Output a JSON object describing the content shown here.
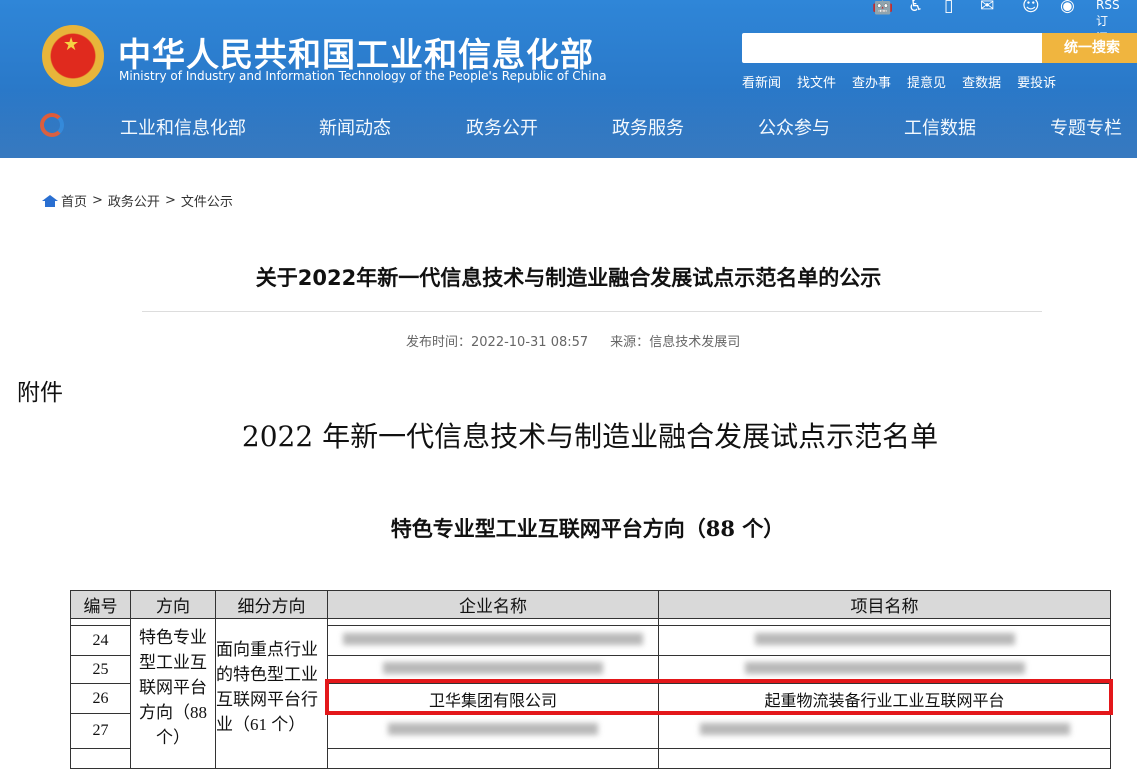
{
  "header": {
    "site_name_cn": "中华人民共和国工业和信息化部",
    "site_name_en": "Ministry of Industry and Information Technology of the People's Republic of China",
    "top_links": {
      "rss": "RSS订阅"
    },
    "search": {
      "placeholder": "",
      "button": "统一搜索"
    },
    "quick_links": [
      "看新闻",
      "找文件",
      "查办事",
      "提意见",
      "查数据",
      "要投诉"
    ],
    "nav": [
      "工业和信息化部",
      "新闻动态",
      "政务公开",
      "政务服务",
      "公众参与",
      "工信数据",
      "专题专栏"
    ]
  },
  "breadcrumb": [
    "首页",
    "政务公开",
    "文件公示"
  ],
  "article": {
    "title": "关于2022年新一代信息技术与制造业融合发展试点示范名单的公示",
    "publish_label": "发布时间：",
    "publish_time": "2022-10-31 08:57",
    "source_label": "来源：",
    "source": "信息技术发展司"
  },
  "document": {
    "attachment": "附件",
    "title": "2022 年新一代信息技术与制造业融合发展试点示范名单",
    "section": "特色专业型工业互联网平台方向（88 个）",
    "table": {
      "headers": [
        "编号",
        "方向",
        "细分方向",
        "企业名称",
        "项目名称"
      ],
      "direction": "特色专业型工业互联网平台方向（88 个）",
      "sub_direction": "面向重点行业的特色型工业互联网平台行业（61 个）",
      "rows": [
        {
          "no": "24",
          "company": "",
          "project": ""
        },
        {
          "no": "25",
          "company": "",
          "project": ""
        },
        {
          "no": "26",
          "company": "卫华集团有限公司",
          "project": "起重物流装备行业工业互联网平台"
        },
        {
          "no": "27",
          "company": "",
          "project": ""
        }
      ]
    }
  },
  "colors": {
    "header_blue": "#2f86d8",
    "search_button": "#f0b53f",
    "highlight": "#e3171a"
  }
}
